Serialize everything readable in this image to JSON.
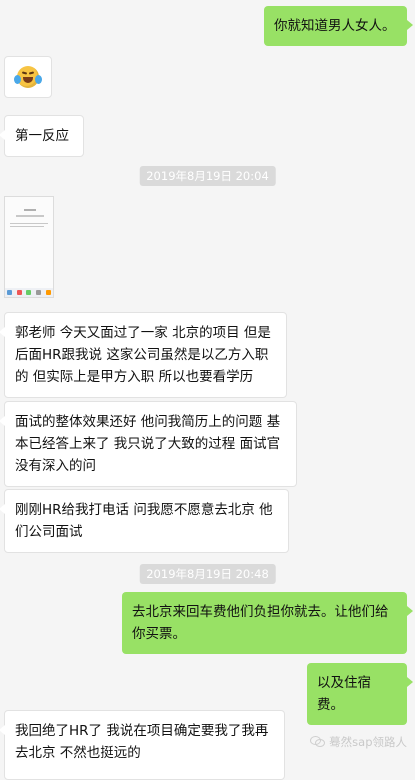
{
  "messages": [
    {
      "side": "out",
      "text": "你就知道男人女人。"
    },
    {
      "side": "in",
      "text": "第一反应"
    },
    {
      "side": "in",
      "text": "郭老师 今天又面过了一家 北京的项目 但是后面HR跟我说 这家公司虽然是以乙方入职的 但实际上是甲方入职 所以也要看学历"
    },
    {
      "side": "in",
      "text": "面试的整体效果还好 他问我简历上的问题 基本已经答上来了 我只说了大致的过程 面试官没有深入的问"
    },
    {
      "side": "in",
      "text": "刚刚HR给我打电话 问我愿不愿意去北京 他们公司面试"
    },
    {
      "side": "out",
      "text": "去北京来回车费他们负担你就去。让他们给你买票。"
    },
    {
      "side": "out",
      "text": "以及住宿费。"
    },
    {
      "side": "in",
      "text": "我回绝了HR了 我说在项目确定要我了我再去北京 不然也挺远的"
    }
  ],
  "timestamps": [
    "2019年8月19日 20:04",
    "2019年8月19日 20:48"
  ],
  "emoji": {
    "icon": "laughing-with-tears-icon"
  },
  "image_thumbnail": {
    "icon": "phone-screenshot-thumbnail"
  },
  "watermark": {
    "text": "蓦然sap领路人",
    "icon": "wechat-logo-icon"
  },
  "colors": {
    "background": "#f5f5f5",
    "outgoing_bubble": "#98e165",
    "incoming_bubble": "#ffffff",
    "timestamp_bg": "#dadada"
  }
}
